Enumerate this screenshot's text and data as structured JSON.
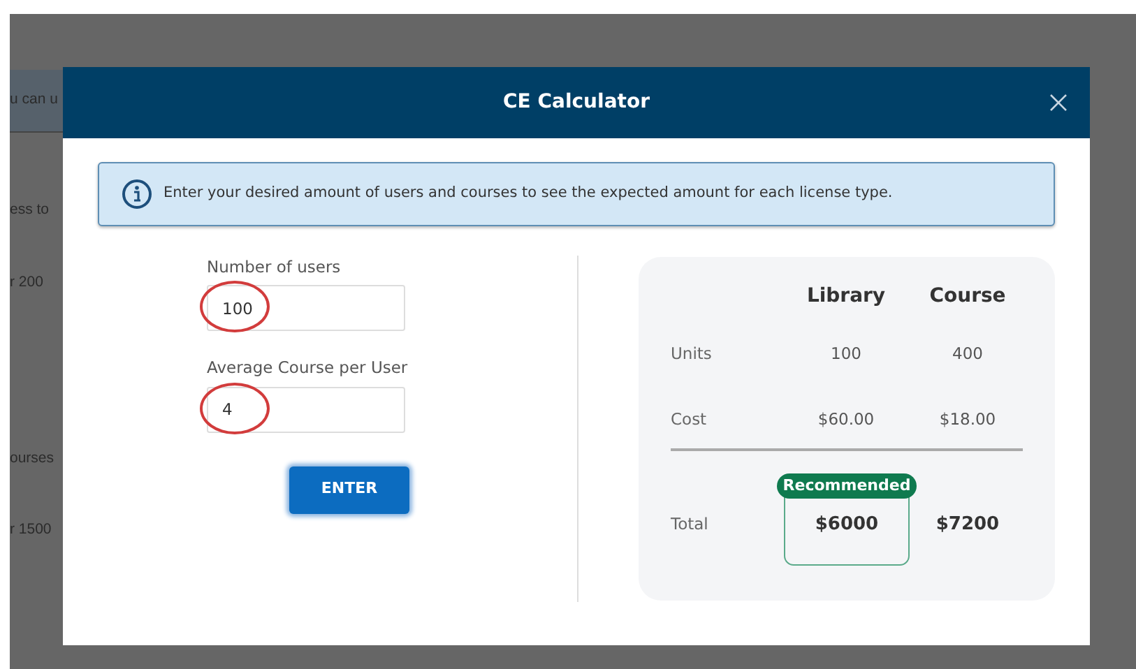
{
  "background_page": {
    "banner": "u can u",
    "items": [
      "ess to",
      "r 200",
      "ourses",
      "r 1500"
    ]
  },
  "dialog": {
    "title": "CE Calculator",
    "info": "Enter your desired amount of users and courses to see the expected amount for each license type.",
    "fields": [
      {
        "label": "Number of users",
        "value": "100",
        "circled": true
      },
      {
        "label": "Average Course per User",
        "value": "4",
        "circled": true
      }
    ],
    "enter_button": "ENTER",
    "table": {
      "columns": [
        "Library",
        "Course"
      ],
      "rows": [
        {
          "label": "Units",
          "values": [
            "100",
            "400"
          ]
        },
        {
          "label": "Cost",
          "values": [
            "$60.00",
            "$18.00"
          ]
        }
      ],
      "total": {
        "label": "Total",
        "values": [
          {
            "value": "$6000",
            "recommended": true,
            "badge": "Recommended"
          },
          {
            "value": "$7200",
            "recommended": false
          }
        ]
      }
    }
  }
}
